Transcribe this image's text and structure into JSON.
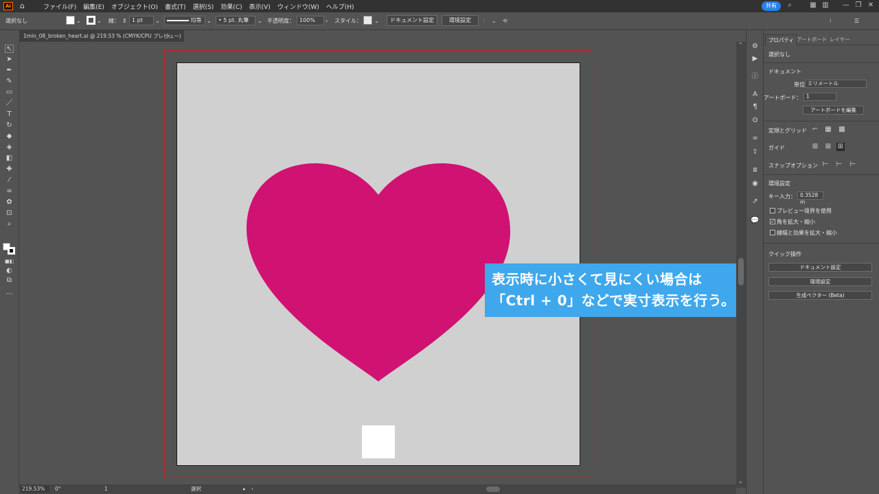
{
  "app": {
    "logo": "Ai",
    "home_icon": "home-icon"
  },
  "menu": [
    "ファイル(F)",
    "編集(E)",
    "オブジェクト(O)",
    "書式(T)",
    "選択(S)",
    "効果(C)",
    "表示(V)",
    "ウィンドウ(W)",
    "ヘルプ(H)"
  ],
  "share_label": "共有",
  "control": {
    "selection_label": "選択なし",
    "stroke_label": "線：",
    "stroke_weight": "1 pt",
    "stroke_style": "均等",
    "brush": "5 pt. 丸筆",
    "opacity_label": "不透明度：",
    "opacity_value": "100%",
    "style_label": "スタイル：",
    "doc_setup_button": "ドキュメント設定",
    "prefs_button": "環境設定"
  },
  "document_tab": {
    "title": "1min_08_broken_heart.ai @ 219.53 % (CMYK/CPU プレビュー)",
    "close": "×"
  },
  "caption": {
    "line1": "表示時に小さくて見にくい場合は",
    "line2": "「Ctrl + 0」などで実寸表示を行う。"
  },
  "colors": {
    "heart": "#d01272",
    "caption_bg": "#3fa7ec",
    "bleed": "#d01c1c",
    "artboard": "#d0d0d0"
  },
  "status": {
    "zoom": "219.53%",
    "rotation": "0°",
    "artboard_num": "1",
    "mode": "選択"
  },
  "panel": {
    "tabs": [
      "プロパティ",
      "アートボード",
      "レイヤー"
    ],
    "no_selection": "選択なし",
    "document_heading": "ドキュメント",
    "units_label": "単位：",
    "units_value": "ミリメートル",
    "artboard_label": "アートボード：",
    "artboard_value": "1",
    "edit_artboards_button": "アートボードを編集",
    "rulers_grids_label": "定規とグリッド",
    "guides_label": "ガイド",
    "snap_label": "スナップオプション",
    "prefs_heading": "環境設定",
    "key_input_label": "キー入力：",
    "key_input_value": "0.3528 m",
    "opt_preview_bounds": "プレビュー境界を使用",
    "opt_scale_corners": "角を拡大・縮小",
    "opt_scale_strokes": "線幅と効果を拡大・縮小",
    "quick_actions_heading": "クイック操作",
    "qa_doc_setup": "ドキュメント設定",
    "qa_prefs": "環境設定",
    "qa_generative_vector": "生成ベクター (Beta)"
  }
}
